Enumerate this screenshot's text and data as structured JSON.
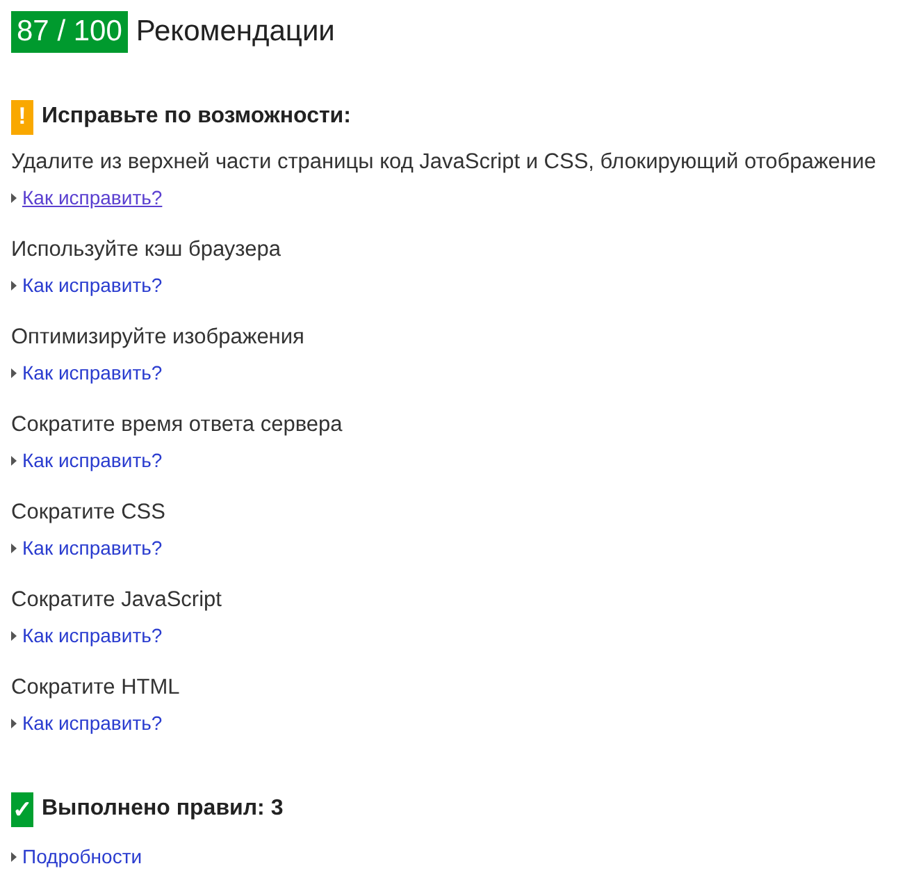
{
  "header": {
    "score": "87 / 100",
    "title": "Рекомендации"
  },
  "fix_section": {
    "icon": "!",
    "title": "Исправьте по возможности:",
    "items": [
      {
        "title": "Удалите из верхней части страницы код JavaScript и CSS, блокирующий отображение",
        "link": "Как исправить?",
        "underlined": true
      },
      {
        "title": "Используйте кэш браузера",
        "link": "Как исправить?",
        "underlined": false
      },
      {
        "title": "Оптимизируйте изображения",
        "link": "Как исправить?",
        "underlined": false
      },
      {
        "title": "Сократите время ответа сервера",
        "link": "Как исправить?",
        "underlined": false
      },
      {
        "title": "Сократите CSS",
        "link": "Как исправить?",
        "underlined": false
      },
      {
        "title": "Сократите JavaScript",
        "link": "Как исправить?",
        "underlined": false
      },
      {
        "title": "Сократите HTML",
        "link": "Как исправить?",
        "underlined": false
      }
    ]
  },
  "passed_section": {
    "icon": "✓",
    "title": "Выполнено правил: 3",
    "link": "Подробности"
  }
}
